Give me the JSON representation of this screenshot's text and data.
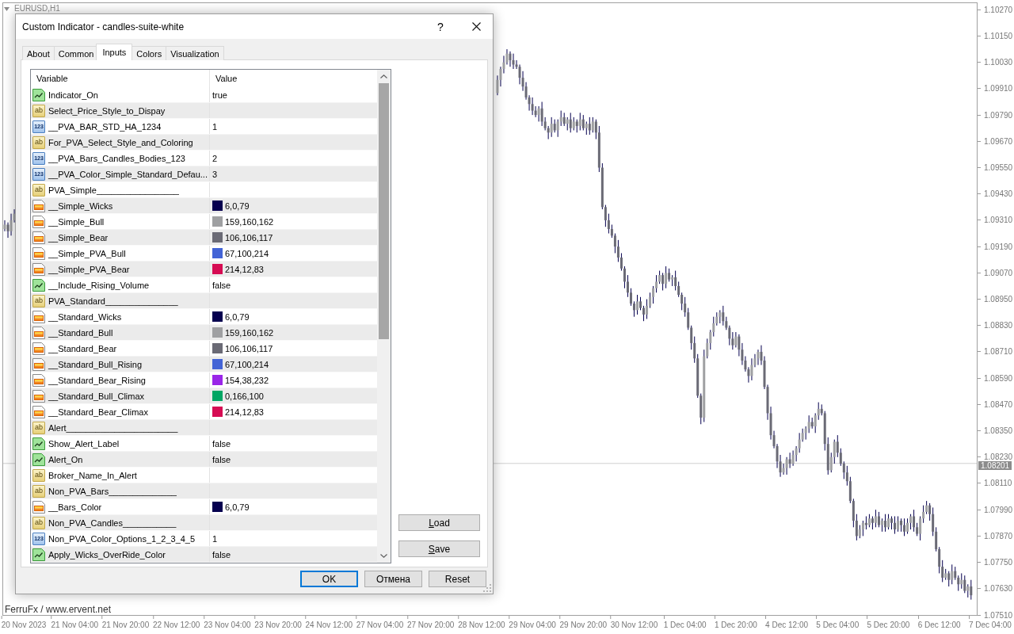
{
  "chart": {
    "symbol": "EURUSD,H1",
    "credit": "FerruFx / www.ervent.net",
    "chart_data": {
      "type": "candlestick",
      "ylim": [
        1.0751,
        1.103
      ],
      "categories": [
        null,
        null,
        null,
        null,
        null,
        null,
        "20 Nov 2023",
        null,
        null,
        null,
        null,
        null,
        null,
        null,
        null,
        null,
        null,
        null,
        null,
        null,
        null,
        null,
        "21 Nov 04:00",
        null,
        null,
        null,
        null,
        null,
        null,
        null,
        null,
        null,
        null,
        null,
        null,
        null,
        null,
        null,
        "21 Nov 20:00",
        null,
        null,
        null,
        null,
        null,
        null,
        null,
        null,
        null,
        null,
        null,
        null,
        null,
        null,
        null,
        "22 Nov 12:00",
        null,
        null,
        null,
        null,
        null,
        null,
        null,
        null,
        null,
        null,
        null,
        null,
        null,
        null,
        null,
        "23 Nov 04:00",
        null,
        null,
        null,
        null,
        null,
        null,
        null,
        null,
        null,
        null,
        null,
        null,
        null,
        null,
        null,
        "23 Nov 20:00",
        null,
        null,
        null,
        null,
        null,
        null,
        null,
        null,
        null,
        null,
        null,
        null,
        null,
        null,
        null,
        "24 Nov 12:00",
        null,
        null,
        null,
        null,
        null,
        null,
        null,
        null,
        null,
        null,
        null,
        null,
        null,
        null,
        null,
        "27 Nov 04:00",
        null,
        null,
        null,
        null,
        null,
        null,
        null,
        null,
        null,
        null,
        null,
        null,
        null,
        null,
        null,
        "27 Nov 20:00",
        null,
        null,
        null,
        null,
        null,
        null,
        null,
        null,
        null,
        null,
        null,
        null,
        null,
        null,
        null,
        "28 Nov 12:00",
        null,
        null,
        null,
        null,
        null,
        null,
        null,
        null,
        null,
        null,
        null,
        null,
        null,
        null,
        null,
        "29 Nov 04:00",
        null,
        null,
        null,
        null,
        null,
        null,
        null,
        null,
        null,
        null,
        null,
        null,
        null,
        null,
        null,
        "29 Nov 20:00",
        null,
        null,
        null,
        null,
        null,
        null,
        null,
        null,
        null,
        null,
        null,
        null,
        null,
        null,
        null,
        "30 Nov 12:00",
        null,
        null,
        null,
        null,
        null,
        null,
        null,
        null,
        null,
        null,
        null,
        null,
        null,
        null,
        null,
        "1 Dec 04:00",
        null,
        null,
        null,
        null,
        null,
        null,
        null,
        null,
        null,
        null,
        null,
        null,
        null,
        null,
        null,
        "1 Dec 20:00",
        null,
        null,
        null,
        null,
        null,
        null,
        null,
        null,
        null,
        null,
        null,
        null,
        null,
        null,
        null,
        "4 Dec 12:00",
        null,
        null,
        null,
        null,
        null,
        null,
        null,
        null,
        null,
        null,
        null,
        null,
        null,
        null,
        null,
        "5 Dec 04:00",
        null,
        null,
        null,
        null,
        null,
        null,
        null,
        null,
        null,
        null,
        null,
        null,
        null,
        null,
        null,
        "5 Dec 20:00",
        null,
        null,
        null,
        null,
        null,
        null,
        null,
        null,
        null,
        null,
        null,
        null,
        null,
        null,
        null,
        "6 Dec 12:00",
        null,
        null,
        null,
        null,
        null,
        null,
        null,
        null,
        null,
        null,
        null,
        null,
        null,
        null,
        null,
        "7 Dec 04:00"
      ],
      "ohlc": [
        [
          1.0927,
          1.0931,
          1.0926,
          1.0929
        ],
        [
          1.0929,
          1.093,
          1.0923,
          1.0926
        ],
        [
          1.0926,
          1.0934,
          1.0924,
          1.0931
        ],
        [
          1.0931,
          1.0936,
          1.093,
          1.0934
        ],
        null,
        null,
        null,
        null,
        null,
        null,
        null,
        null,
        null,
        null,
        null,
        null,
        null,
        null,
        null,
        null,
        null,
        null,
        null,
        null,
        null,
        null,
        null,
        null,
        null,
        null,
        null,
        null,
        null,
        null,
        null,
        null,
        null,
        null,
        null,
        null,
        null,
        null,
        null,
        null,
        null,
        null,
        null,
        null,
        null,
        null,
        null,
        null,
        null,
        null,
        null,
        null,
        null,
        null,
        null,
        null,
        null,
        null,
        null,
        null,
        null,
        null,
        null,
        null,
        null,
        null,
        null,
        null,
        null,
        null,
        null,
        null,
        null,
        null,
        null,
        null,
        null,
        null,
        null,
        null,
        null,
        null,
        null,
        null,
        null,
        null,
        null,
        null,
        null,
        null,
        null,
        null,
        null,
        null,
        null,
        null,
        null,
        null,
        null,
        null,
        null,
        null,
        null,
        null,
        null,
        null,
        null,
        null,
        null,
        null,
        null,
        null,
        null,
        null,
        null,
        null,
        null,
        null,
        null,
        null,
        null,
        null,
        null,
        null,
        null,
        null,
        null,
        null,
        null,
        null,
        null,
        null,
        null,
        null,
        null,
        null,
        null,
        null,
        null,
        null,
        null,
        null,
        null,
        null,
        null,
        null,
        null,
        null,
        null,
        null,
        null,
        [
          1.0989,
          1.0997,
          1.0988,
          1.0995
        ],
        [
          1.0995,
          1.1001,
          1.0992,
          1.1
        ],
        [
          1.1,
          1.1006,
          1.0998,
          1.1003
        ],
        [
          1.1003,
          1.1009,
          1.1002,
          1.1007
        ],
        [
          1.1007,
          1.1008,
          1.1001,
          1.1004
        ],
        [
          1.1004,
          1.1007,
          1.1,
          1.1002
        ],
        [
          1.1002,
          1.1004,
          1.1,
          1.1001
        ],
        [
          1.1001,
          1.1002,
          1.0993,
          1.0996
        ],
        [
          1.0996,
          1.0999,
          1.099,
          1.0992
        ],
        [
          1.0992,
          1.0994,
          1.0986,
          1.0987
        ],
        [
          1.0987,
          1.0988,
          1.0981,
          1.0984
        ],
        [
          1.0984,
          1.0987,
          1.0979,
          1.0981
        ],
        [
          1.0981,
          1.0983,
          1.0978,
          1.0979
        ],
        [
          1.0979,
          1.0983,
          1.0976,
          1.0982
        ],
        [
          1.0982,
          1.0985,
          1.0974,
          1.0976
        ],
        [
          1.0976,
          1.0978,
          1.0972,
          1.0973
        ],
        [
          1.0973,
          1.0974,
          1.0968,
          1.0971
        ],
        [
          1.0971,
          1.0978,
          1.0969,
          1.0975
        ],
        [
          1.0975,
          1.0977,
          1.0971,
          1.0972
        ],
        [
          1.0972,
          1.0977,
          1.0969,
          1.0976
        ],
        [
          1.0976,
          1.0981,
          1.0974,
          1.0978
        ],
        [
          1.0978,
          1.098,
          1.0974,
          1.0975
        ],
        [
          1.0975,
          1.0978,
          1.0972,
          1.0977
        ],
        [
          1.0977,
          1.098,
          1.0971,
          1.0973
        ],
        [
          1.0973,
          1.0978,
          1.0972,
          1.0976
        ],
        [
          1.0976,
          1.0977,
          1.0971,
          1.0974
        ],
        [
          1.0974,
          1.098,
          1.0972,
          1.0977
        ],
        [
          1.0977,
          1.0979,
          1.0972,
          1.0973
        ],
        [
          1.0973,
          1.0976,
          1.097,
          1.0975
        ],
        [
          1.0975,
          1.0978,
          1.097,
          1.0972
        ],
        [
          1.0972,
          1.0978,
          1.0971,
          1.0976
        ],
        [
          1.0976,
          1.0977,
          1.0968,
          1.0971
        ],
        [
          1.0971,
          1.0974,
          1.0953,
          1.0955
        ],
        [
          1.0955,
          1.0957,
          1.0936,
          1.0937
        ],
        [
          1.0937,
          1.0938,
          1.0928,
          1.0931
        ],
        [
          1.0931,
          1.0934,
          1.0925,
          1.0927
        ],
        [
          1.0927,
          1.0929,
          1.0923,
          1.0924
        ],
        [
          1.0924,
          1.0925,
          1.0916,
          1.0919
        ],
        [
          1.0919,
          1.0922,
          1.0912,
          1.0914
        ],
        [
          1.0914,
          1.0916,
          1.0908,
          1.0909
        ],
        [
          1.0909,
          1.091,
          1.09,
          1.0903
        ],
        [
          1.0903,
          1.0906,
          1.0896,
          1.0898
        ],
        [
          1.0898,
          1.09,
          1.0892,
          1.0893
        ],
        [
          1.0893,
          1.0894,
          1.0887,
          1.089
        ],
        [
          1.089,
          1.0897,
          1.0888,
          1.0894
        ],
        [
          1.0894,
          1.0896,
          1.089,
          1.0891
        ],
        [
          1.0891,
          1.0892,
          1.0885,
          1.0888
        ],
        [
          1.0888,
          1.0895,
          1.0886,
          1.0892
        ],
        [
          1.0892,
          1.0898,
          1.0891,
          1.0896
        ],
        [
          1.0896,
          1.0901,
          1.0893,
          1.09
        ],
        [
          1.09,
          1.0906,
          1.0898,
          1.0903
        ],
        [
          1.0903,
          1.0908,
          1.0902,
          1.0906
        ],
        [
          1.0906,
          1.0907,
          1.0899,
          1.0902
        ],
        [
          1.0902,
          1.091,
          1.09,
          1.0907
        ],
        [
          1.0907,
          1.0909,
          1.0903,
          1.0904
        ],
        [
          1.0904,
          1.0906,
          1.0901,
          1.0905
        ],
        [
          1.0905,
          1.0908,
          1.0899,
          1.0901
        ],
        [
          1.0901,
          1.0903,
          1.0896,
          1.0897
        ],
        [
          1.0897,
          1.0898,
          1.089,
          1.0893
        ],
        [
          1.0893,
          1.0896,
          1.0887,
          1.0889
        ],
        [
          1.0889,
          1.0891,
          1.0881,
          1.0882
        ],
        [
          1.0882,
          1.0883,
          1.0872,
          1.0875
        ],
        [
          1.0875,
          1.0878,
          1.0866,
          1.0868
        ],
        [
          1.0868,
          1.087,
          1.085,
          1.0851
        ],
        [
          1.0851,
          1.0852,
          1.0838,
          1.0841
        ],
        [
          1.0841,
          1.0872,
          1.0839,
          1.0869
        ],
        [
          1.0869,
          1.0877,
          1.0868,
          1.0875
        ],
        [
          1.0875,
          1.0881,
          1.0872,
          1.088
        ],
        [
          1.088,
          1.0887,
          1.0878,
          1.0884
        ],
        [
          1.0884,
          1.0889,
          1.0883,
          1.0887
        ],
        [
          1.0887,
          1.089,
          1.0884,
          1.0889
        ],
        [
          1.0889,
          1.0892,
          1.0883,
          1.0885
        ],
        [
          1.0885,
          1.0887,
          1.0881,
          1.0882
        ],
        [
          1.0882,
          1.0883,
          1.0874,
          1.0877
        ],
        [
          1.0877,
          1.088,
          1.0872,
          1.0874
        ],
        [
          1.0874,
          1.088,
          1.0873,
          1.0878
        ],
        [
          1.0878,
          1.0879,
          1.0869,
          1.0872
        ],
        [
          1.0872,
          1.0875,
          1.0865,
          1.0867
        ],
        [
          1.0867,
          1.0869,
          1.0862,
          1.0863
        ],
        [
          1.0863,
          1.0864,
          1.0857,
          1.086
        ],
        [
          1.086,
          1.0868,
          1.0858,
          1.0865
        ],
        [
          1.0865,
          1.087,
          1.0864,
          1.0868
        ],
        [
          1.0868,
          1.0872,
          1.0865,
          1.0871
        ],
        [
          1.0871,
          1.0874,
          1.0865,
          1.0867
        ],
        [
          1.0867,
          1.0869,
          1.0854,
          1.0855
        ],
        [
          1.0855,
          1.0856,
          1.084,
          1.0843
        ],
        [
          1.0843,
          1.0846,
          1.0831,
          1.0833
        ],
        [
          1.0833,
          1.0835,
          1.0827,
          1.0828
        ],
        [
          1.0828,
          1.0829,
          1.0818,
          1.0821
        ],
        [
          1.0821,
          1.0824,
          1.0814,
          1.0816
        ],
        [
          1.0816,
          1.082,
          1.0815,
          1.0818
        ],
        [
          1.0818,
          1.0823,
          1.0815,
          1.0822
        ],
        [
          1.0822,
          1.0825,
          1.0818,
          1.082
        ],
        [
          1.082,
          1.0826,
          1.0819,
          1.0824
        ],
        [
          1.0824,
          1.0828,
          1.0821,
          1.0827
        ],
        [
          1.0827,
          1.0834,
          1.0825,
          1.0831
        ],
        [
          1.0831,
          1.0836,
          1.083,
          1.0834
        ],
        [
          1.0834,
          1.0837,
          1.0831,
          1.0836
        ],
        [
          1.0836,
          1.0842,
          1.0834,
          1.0839
        ],
        [
          1.0839,
          1.0841,
          1.0836,
          1.0837
        ],
        [
          1.0837,
          1.0843,
          1.0834,
          1.0842
        ],
        [
          1.0842,
          1.0848,
          1.084,
          1.0845
        ],
        [
          1.0845,
          1.0847,
          1.0842,
          1.0843
        ],
        [
          1.0843,
          1.0844,
          1.0826,
          1.0829
        ],
        [
          1.0829,
          1.0832,
          1.0815,
          1.0817
        ],
        [
          1.0817,
          1.0825,
          1.0816,
          1.0823
        ],
        [
          1.0823,
          1.0831,
          1.082,
          1.083
        ],
        [
          1.083,
          1.0833,
          1.0823,
          1.0825
        ],
        [
          1.0825,
          1.0827,
          1.0819,
          1.082
        ],
        [
          1.082,
          1.0821,
          1.0813,
          1.0816
        ],
        [
          1.0816,
          1.0819,
          1.081,
          1.0812
        ],
        [
          1.0812,
          1.0814,
          1.0802,
          1.0803
        ],
        [
          1.0803,
          1.0804,
          1.0791,
          1.0794
        ],
        [
          1.0794,
          1.0797,
          1.0785,
          1.0787
        ],
        [
          1.0787,
          1.0792,
          1.0786,
          1.079
        ],
        [
          1.079,
          1.0794,
          1.0787,
          1.0793
        ],
        [
          1.0793,
          1.0796,
          1.079,
          1.0792
        ],
        [
          1.0792,
          1.0797,
          1.0791,
          1.0795
        ],
        [
          1.0795,
          1.0796,
          1.079,
          1.0793
        ],
        [
          1.0793,
          1.0799,
          1.0791,
          1.0796
        ],
        [
          1.0796,
          1.0798,
          1.0791,
          1.0792
        ],
        [
          1.0792,
          1.0795,
          1.0789,
          1.0794
        ],
        [
          1.0794,
          1.0797,
          1.0789,
          1.0791
        ],
        [
          1.0791,
          1.0797,
          1.079,
          1.0795
        ],
        [
          1.0795,
          1.0796,
          1.079,
          1.0793
        ],
        [
          1.0793,
          1.0796,
          1.0788,
          1.079
        ],
        [
          1.079,
          1.0796,
          1.0789,
          1.0794
        ],
        [
          1.0794,
          1.0795,
          1.0789,
          1.0792
        ],
        [
          1.0792,
          1.0795,
          1.0787,
          1.0789
        ],
        [
          1.0789,
          1.0795,
          1.0788,
          1.0793
        ],
        [
          1.0793,
          1.0797,
          1.079,
          1.0796
        ],
        [
          1.0796,
          1.0799,
          1.0789,
          1.0791
        ],
        [
          1.0791,
          1.0793,
          1.0787,
          1.0788
        ],
        [
          1.0788,
          1.0796,
          1.0785,
          1.0795
        ],
        [
          1.0795,
          1.0801,
          1.0793,
          1.0798
        ],
        [
          1.0798,
          1.0803,
          1.0797,
          1.0801
        ],
        [
          1.0801,
          1.0802,
          1.0794,
          1.0797
        ],
        [
          1.0797,
          1.08,
          1.0787,
          1.0789
        ],
        [
          1.0789,
          1.0791,
          1.078,
          1.0781
        ],
        [
          1.0781,
          1.0782,
          1.077,
          1.0773
        ],
        [
          1.0773,
          1.0776,
          1.0766,
          1.0768
        ],
        [
          1.0768,
          1.0772,
          1.0767,
          1.077
        ],
        [
          1.077,
          1.0771,
          1.0764,
          1.0767
        ],
        [
          1.0767,
          1.0774,
          1.0765,
          1.0771
        ],
        [
          1.0771,
          1.0773,
          1.0767,
          1.0768
        ],
        [
          1.0768,
          1.0769,
          1.0762,
          1.0765
        ],
        [
          1.0765,
          1.077,
          1.0763,
          1.0767
        ],
        [
          1.0767,
          1.0769,
          1.0761,
          1.0762
        ],
        [
          1.0762,
          1.0765,
          1.0759,
          1.0764
        ],
        [
          1.0764,
          1.0767,
          1.0758,
          1.076
        ],
        null,
        null,
        null,
        null,
        null,
        null
      ],
      "yticks": [
        {
          "value": 1.1027,
          "label": "1.10270"
        },
        {
          "value": 1.1015,
          "label": "1.10150"
        },
        {
          "value": 1.1003,
          "label": "1.10030"
        },
        {
          "value": 1.0991,
          "label": "1.09910"
        },
        {
          "value": 1.0979,
          "label": "1.09790"
        },
        {
          "value": 1.0967,
          "label": "1.09670"
        },
        {
          "value": 1.0955,
          "label": "1.09550"
        },
        {
          "value": 1.0943,
          "label": "1.09430"
        },
        {
          "value": 1.0931,
          "label": "1.09310"
        },
        {
          "value": 1.0919,
          "label": "1.09190"
        },
        {
          "value": 1.0907,
          "label": "1.09070"
        },
        {
          "value": 1.0895,
          "label": "1.08950"
        },
        {
          "value": 1.0883,
          "label": "1.08830"
        },
        {
          "value": 1.0871,
          "label": "1.08710"
        },
        {
          "value": 1.0859,
          "label": "1.08590"
        },
        {
          "value": 1.0847,
          "label": "1.08470"
        },
        {
          "value": 1.0835,
          "label": "1.08350"
        },
        {
          "value": 1.0823,
          "label": "1.08230"
        },
        {
          "value": 1.0811,
          "label": "1.08110"
        },
        {
          "value": 1.0799,
          "label": "1.07990"
        },
        {
          "value": 1.0787,
          "label": "1.07870"
        },
        {
          "value": 1.0775,
          "label": "1.07750"
        },
        {
          "value": 1.0763,
          "label": "1.07630"
        },
        {
          "value": 1.0751,
          "label": "1.07510"
        }
      ],
      "ref_lines": [
        {
          "axis": "y",
          "value": 1.08201,
          "label": "1.08201"
        }
      ]
    }
  },
  "dialog": {
    "title": "Custom Indicator - candles-suite-white",
    "help_button": "?",
    "tabs": [
      {
        "label": "About",
        "selected": false
      },
      {
        "label": "Common",
        "selected": false
      },
      {
        "label": "Inputs",
        "selected": true
      },
      {
        "label": "Colors",
        "selected": false
      },
      {
        "label": "Visualization",
        "selected": false
      }
    ],
    "columns": [
      "Variable",
      "Value"
    ],
    "rows": [
      {
        "kind": "bool",
        "name": "Indicator_On",
        "value": "true"
      },
      {
        "kind": "string",
        "badge": "ab",
        "name": "Select_Price_Style_to_Dispay"
      },
      {
        "kind": "int",
        "badge": "123",
        "name": "__PVA_BAR_STD_HA_1234",
        "value": "1"
      },
      {
        "kind": "string",
        "badge": "ab",
        "name": "For_PVA_Select_Style_and_Coloring"
      },
      {
        "kind": "int",
        "badge": "123",
        "name": "__PVA_Bars_Candles_Bodies_123",
        "value": "2"
      },
      {
        "kind": "int",
        "badge": "123",
        "name": "__PVA_Color_Simple_Standard_Defau...",
        "value": "3"
      },
      {
        "kind": "string",
        "badge": "ab",
        "name": "PVA_Simple_________________"
      },
      {
        "kind": "color",
        "name": "__Simple_Wicks",
        "value": "6,0,79",
        "color": "#06004f"
      },
      {
        "kind": "color",
        "name": "__Simple_Bull",
        "value": "159,160,162",
        "color": "#9fa0a2"
      },
      {
        "kind": "color",
        "name": "__Simple_Bear",
        "value": "106,106,117",
        "color": "#6a6a75"
      },
      {
        "kind": "color",
        "name": "__Simple_PVA_Bull",
        "value": "67,100,214",
        "color": "#4364d6"
      },
      {
        "kind": "color",
        "name": "__Simple_PVA_Bear",
        "value": "214,12,83",
        "color": "#d60c53"
      },
      {
        "kind": "bool",
        "name": "__Include_Rising_Volume",
        "value": "false"
      },
      {
        "kind": "string",
        "badge": "ab",
        "name": "PVA_Standard_______________"
      },
      {
        "kind": "color",
        "name": "__Standard_Wicks",
        "value": "6,0,79",
        "color": "#06004f"
      },
      {
        "kind": "color",
        "name": "__Standard_Bull",
        "value": "159,160,162",
        "color": "#9fa0a2"
      },
      {
        "kind": "color",
        "name": "__Standard_Bear",
        "value": "106,106,117",
        "color": "#6a6a75"
      },
      {
        "kind": "color",
        "name": "__Standard_Bull_Rising",
        "value": "67,100,214",
        "color": "#4364d6"
      },
      {
        "kind": "color",
        "name": "__Standard_Bear_Rising",
        "value": "154,38,232",
        "color": "#9a26e8"
      },
      {
        "kind": "color",
        "name": "__Standard_Bull_Climax",
        "value": "0,166,100",
        "color": "#00a664"
      },
      {
        "kind": "color",
        "name": "__Standard_Bear_Climax",
        "value": "214,12,83",
        "color": "#d60c53"
      },
      {
        "kind": "string",
        "badge": "ab",
        "name": "Alert_______________________"
      },
      {
        "kind": "bool",
        "name": "Show_Alert_Label",
        "value": "false"
      },
      {
        "kind": "bool",
        "name": "Alert_On",
        "value": "false"
      },
      {
        "kind": "string",
        "badge": "ab",
        "name": "Broker_Name_In_Alert"
      },
      {
        "kind": "string",
        "badge": "ab",
        "name": "Non_PVA_Bars______________"
      },
      {
        "kind": "color",
        "name": "__Bars_Color",
        "value": "6,0,79",
        "color": "#06004f"
      },
      {
        "kind": "string",
        "badge": "ab",
        "name": "Non_PVA_Candles___________"
      },
      {
        "kind": "int",
        "badge": "123",
        "name": "Non_PVA_Color_Options_1_2_3_4_5",
        "value": "1"
      },
      {
        "kind": "bool",
        "name": "Apply_Wicks_OverRide_Color",
        "value": "false"
      }
    ],
    "side_buttons": [
      {
        "label": "Load",
        "access_key_underlined": true
      },
      {
        "label": "Save",
        "access_key_underlined": true
      }
    ],
    "buttons": [
      {
        "label": "OK",
        "focused": true
      },
      {
        "label": "Отмена",
        "focused": false
      },
      {
        "label": "Reset",
        "focused": false
      }
    ]
  }
}
